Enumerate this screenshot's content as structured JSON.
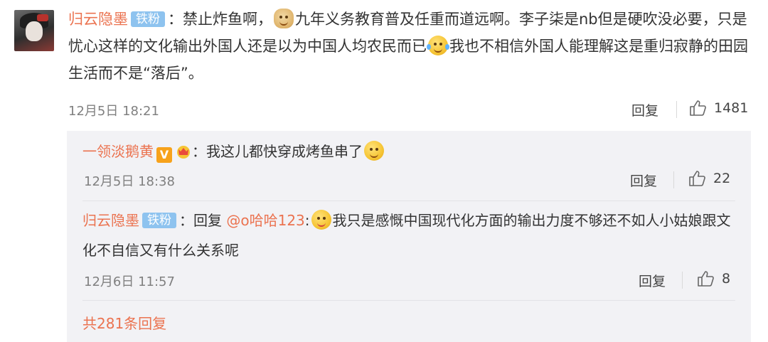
{
  "comment": {
    "username": "归云隐墨",
    "badge": "铁粉",
    "sep": "：",
    "text1": "禁止炸鱼啊，",
    "emoji_doge": "doge",
    "text2": "九年义务教育普及任重而道远啊。李子柒是nb但是硬吹没必要，只是忧心这样的文化输出外国人还是以为中国人均农民而已",
    "emoji_laugh": "笑cry",
    "text3": "我也不相信外国人能理解这是重归寂静的田园生活而不是“落后”。",
    "time": "12月5日 18:21",
    "reply_label": "回复",
    "like_count": "1481"
  },
  "replies": [
    {
      "username": "一领淡鹅黄",
      "vip_icon": "V",
      "crown_icon": "crown-icon",
      "sep": "：",
      "text": "我这儿都快穿成烤鱼串了",
      "emoji": "smile",
      "time": "12月5日 18:38",
      "reply_label": "回复",
      "like_count": "22"
    },
    {
      "username": "归云隐墨",
      "badge": "铁粉",
      "sep": "：",
      "reply_prefix": "回复",
      "mention": "@o哈哈123",
      "colon": ":",
      "emoji": "hungry",
      "text": "我只是感慨中国现代化方面的输出力度不够还不如人小姑娘跟文化不自信又有什么关系呢",
      "time": "12月6日 11:57",
      "reply_label": "回复",
      "like_count": "8"
    }
  ],
  "total_replies": "共281条回复",
  "colors": {
    "username": "#eb7350",
    "badge": "#8ec3ef",
    "replies_bg": "#f2f2f5"
  }
}
